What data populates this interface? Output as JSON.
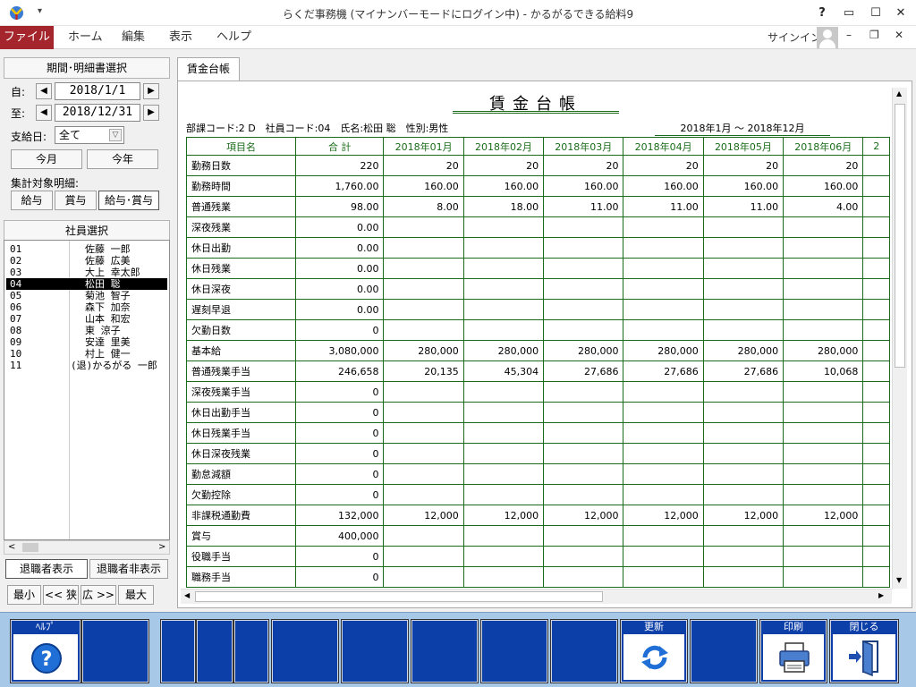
{
  "window": {
    "title": "らくだ事務機 (マイナンバーモードにログイン中) - かるがるできる給料9"
  },
  "ribbon": {
    "file": "ファイル",
    "tabs": [
      "ホーム",
      "編集",
      "表示",
      "ヘルプ"
    ],
    "signin": "サインイン"
  },
  "left": {
    "period_header": "期間･明細書選択",
    "from_label": "自:",
    "from_date": "2018/1/1",
    "to_label": "至:",
    "to_date": "2018/12/31",
    "payday_label": "支給日:",
    "payday_value": "全て",
    "this_month": "今月",
    "this_year": "今年",
    "target_label": "集計対象明細:",
    "target_opts": [
      "給与",
      "賞与",
      "給与･賞与"
    ],
    "emp_header": "社員選択",
    "employees": [
      {
        "code": "01",
        "name": "佐藤 一郎"
      },
      {
        "code": "02",
        "name": "佐藤 広美"
      },
      {
        "code": "03",
        "name": "大上 幸太郎"
      },
      {
        "code": "04",
        "name": "松田 聡"
      },
      {
        "code": "05",
        "name": "菊池 智子"
      },
      {
        "code": "06",
        "name": "森下 加奈"
      },
      {
        "code": "07",
        "name": "山本 和宏"
      },
      {
        "code": "08",
        "name": "東 涼子"
      },
      {
        "code": "09",
        "name": "安達 里美"
      },
      {
        "code": "10",
        "name": "村上 健一"
      },
      {
        "code": "11",
        "name": "(退)かるがる 一郎"
      }
    ],
    "show_retired": "退職者表示",
    "hide_retired": "退職者非表示",
    "zoom": [
      "最小",
      "<< 狭",
      "広 >>",
      "最大"
    ]
  },
  "content": {
    "tab": "賃金台帳",
    "title": "賃金台帳",
    "info": "部課コード:2 D　社員コード:04　氏名:松田 聡　性別:男性",
    "period": "2018年1月 〜 2018年12月",
    "headers": [
      "項目名",
      "合 計",
      "2018年01月",
      "2018年02月",
      "2018年03月",
      "2018年04月",
      "2018年05月",
      "2018年06月",
      "2"
    ],
    "rows": [
      [
        "勤務日数",
        "220",
        "20",
        "20",
        "20",
        "20",
        "20",
        "20"
      ],
      [
        "勤務時間",
        "1,760.00",
        "160.00",
        "160.00",
        "160.00",
        "160.00",
        "160.00",
        "160.00"
      ],
      [
        "普通残業",
        "98.00",
        "8.00",
        "18.00",
        "11.00",
        "11.00",
        "11.00",
        "4.00"
      ],
      [
        "深夜残業",
        "0.00",
        "",
        "",
        "",
        "",
        "",
        ""
      ],
      [
        "休日出勤",
        "0.00",
        "",
        "",
        "",
        "",
        "",
        ""
      ],
      [
        "休日残業",
        "0.00",
        "",
        "",
        "",
        "",
        "",
        ""
      ],
      [
        "休日深夜",
        "0.00",
        "",
        "",
        "",
        "",
        "",
        ""
      ],
      [
        "遅刻早退",
        "0.00",
        "",
        "",
        "",
        "",
        "",
        ""
      ],
      [
        "欠勤日数",
        "0",
        "",
        "",
        "",
        "",
        "",
        ""
      ],
      [
        "基本給",
        "3,080,000",
        "280,000",
        "280,000",
        "280,000",
        "280,000",
        "280,000",
        "280,000"
      ],
      [
        "普通残業手当",
        "246,658",
        "20,135",
        "45,304",
        "27,686",
        "27,686",
        "27,686",
        "10,068"
      ],
      [
        "深夜残業手当",
        "0",
        "",
        "",
        "",
        "",
        "",
        ""
      ],
      [
        "休日出勤手当",
        "0",
        "",
        "",
        "",
        "",
        "",
        ""
      ],
      [
        "休日残業手当",
        "0",
        "",
        "",
        "",
        "",
        "",
        ""
      ],
      [
        "休日深夜残業",
        "0",
        "",
        "",
        "",
        "",
        "",
        ""
      ],
      [
        "勤怠減額",
        "0",
        "",
        "",
        "",
        "",
        "",
        ""
      ],
      [
        "欠勤控除",
        "0",
        "",
        "",
        "",
        "",
        "",
        ""
      ],
      [
        "非課税通勤費",
        "132,000",
        "12,000",
        "12,000",
        "12,000",
        "12,000",
        "12,000",
        "12,000"
      ],
      [
        "賞与",
        "400,000",
        "",
        "",
        "",
        "",
        "",
        ""
      ],
      [
        "役職手当",
        "0",
        "",
        "",
        "",
        "",
        "",
        ""
      ],
      [
        "職務手当",
        "0",
        "",
        "",
        "",
        "",
        "",
        ""
      ]
    ]
  },
  "footer": {
    "help": "ﾍﾙﾌﾟ",
    "update": "更新",
    "print": "印刷",
    "close": "閉じる"
  }
}
